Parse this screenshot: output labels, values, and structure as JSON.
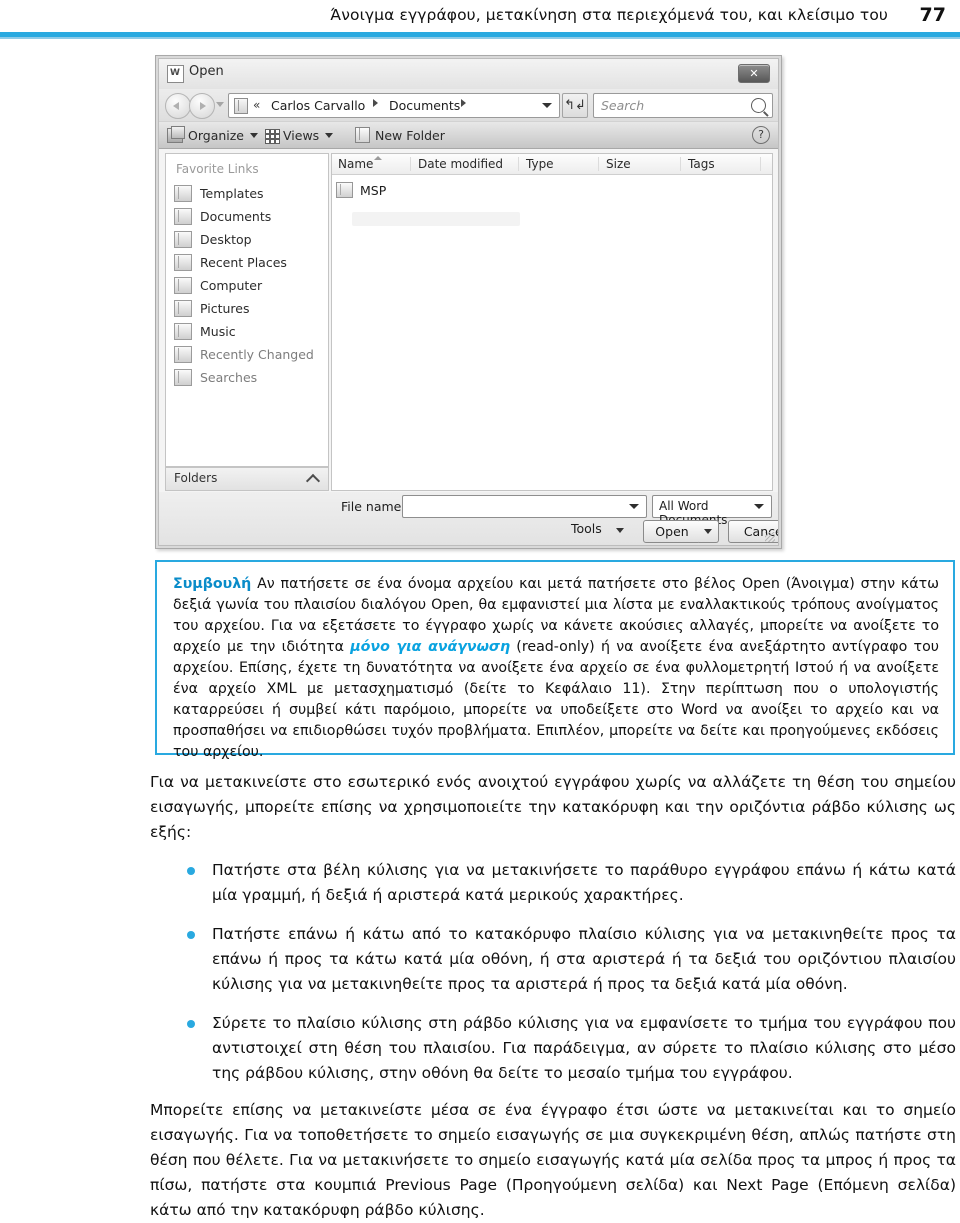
{
  "header": {
    "title": "Άνοιγμα εγγράφου, μετακίνηση στα περιεχόμενά του, και κλείσιμο του",
    "page_number": "77",
    "rule_color": "#29a9e0"
  },
  "dialog": {
    "title": "Open",
    "title_icon": "word-document-icon",
    "close_label": "✕",
    "nav": {
      "back_icon": "back-arrow-icon",
      "forward_icon": "forward-arrow-icon",
      "history_icon": "chevron-down-icon",
      "folder_icon": "folder-icon",
      "chevrons": "«",
      "breadcrumbs": [
        "Carlos Carvallo",
        "Documents"
      ],
      "address_dropdown_icon": "chevron-down-icon",
      "refresh_icon": "↰↲",
      "search_placeholder": "Search",
      "search_value": "",
      "search_icon": "search-icon"
    },
    "toolbar": {
      "organize_label": "Organize",
      "views_label": "Views",
      "new_folder_label": "New Folder",
      "help_label": "?"
    },
    "sidebar": {
      "title": "Favorite Links",
      "items": [
        {
          "label": "Templates",
          "icon": "folder-icon"
        },
        {
          "label": "Documents",
          "icon": "documents-icon"
        },
        {
          "label": "Desktop",
          "icon": "desktop-icon"
        },
        {
          "label": "Recent Places",
          "icon": "recent-places-icon"
        },
        {
          "label": "Computer",
          "icon": "computer-icon"
        },
        {
          "label": "Pictures",
          "icon": "pictures-icon"
        },
        {
          "label": "Music",
          "icon": "music-icon"
        },
        {
          "label": "Recently Changed",
          "icon": "recently-changed-icon"
        },
        {
          "label": "Searches",
          "icon": "searches-icon"
        }
      ],
      "folders_label": "Folders",
      "folders_chevron": "collapse-chevron-icon"
    },
    "filepane": {
      "columns": [
        "Name",
        "Date modified",
        "Type",
        "Size",
        "Tags"
      ],
      "sort_column": "Name",
      "sort_direction": "ascending",
      "rows": [
        {
          "name": "MSP",
          "date_modified": "",
          "type": "",
          "size": "",
          "tags": "",
          "icon": "folder-icon"
        }
      ]
    },
    "footer": {
      "file_name_label": "File name:",
      "file_name_value": "",
      "file_type_value": "All Word Documents",
      "tools_label": "Tools",
      "open_label": "Open",
      "cancel_label": "Cancel"
    }
  },
  "tip": {
    "label": "Συμβουλή",
    "text_before_em": " Αν πατήσετε σε ένα όνομα αρχείου και μετά πατήσετε στο βέλος Open (Άνοιγμα) στην κάτω δεξιά γωνία του πλαισίου διαλόγου Open, θα εμφανιστεί μια λίστα με εναλλακτικούς τρόπους ανοίγματος του αρχείου. Για να εξετάσετε το έγγραφο χωρίς να κάνετε ακούσιες αλλαγές, μπορείτε να ανοίξετε το αρχείο με την ιδιότητα ",
    "emphasis": "μόνο για ανάγνωση",
    "text_after_em": " (read-only) ή να ανοίξετε ένα ανεξάρτητο αντίγραφο του αρχείου. Επίσης, έχετε τη δυνατότητα να ανοίξετε ένα αρχείο σε ένα φυλλομετρητή Ιστού ή να ανοίξετε ένα αρχείο XML με μετασχηματισμό (δείτε το Κεφάλαιο 11). Στην περίπτωση που ο υπολογιστής καταρρεύσει ή συμβεί κάτι παρόμοιο, μπορείτε να υποδείξετε στο Word να ανοίξει το αρχείο και να προσπαθήσει να επιδιορθώσει τυχόν προβλήματα. Επιπλέον, μπορείτε να δείτε και προηγούμενες εκδόσεις του αρχείου."
  },
  "content": {
    "intro_paragraph": "Για να μετακινείστε στο εσωτερικό ενός ανοιχτού εγγράφου χωρίς να αλλάζετε τη θέση του σημείου εισαγωγής, μπορείτε επίσης να χρησιμοποιείτε την κατακόρυφη και την οριζόντια ράβδο κύλισης ως εξής:",
    "bullets": [
      "Πατήστε στα βέλη κύλισης για να μετακινήσετε το παράθυρο εγγράφου επάνω ή κάτω κατά μία γραμμή, ή δεξιά ή αριστερά κατά μερικούς χαρακτήρες.",
      "Πατήστε επάνω ή κάτω από το κατακόρυφο πλαίσιο κύλισης για να μετακινηθείτε προς τα επάνω ή προς τα κάτω κατά μία οθόνη, ή στα αριστερά ή τα δεξιά του οριζόντιου πλαισίου κύλισης για να μετακινηθείτε προς τα αριστερά ή προς τα δεξιά κατά μία οθόνη.",
      "Σύρετε το πλαίσιο κύλισης στη ράβδο κύλισης για να εμφανίσετε το τμήμα του εγγράφου που αντιστοιχεί στη θέση του πλαισίου. Για παράδειγμα, αν σύρετε το πλαίσιο κύλισης στο μέσο της ράβδου κύλισης, στην οθόνη θα δείτε το μεσαίο τμήμα του εγγράφου."
    ],
    "final_paragraph": "Μπορείτε επίσης να μετακινείστε μέσα σε ένα έγγραφο έτσι ώστε να μετακινείται και το σημείο εισαγωγής. Για να τοποθετήσετε το σημείο εισαγωγής σε μια συγκεκριμένη θέση, απλώς πατήστε στη θέση που θέλετε. Για να μετακινήσετε το σημείο εισαγωγής κατά μία σελίδα προς τα μπρος ή προς τα πίσω, πατήστε στα κουμπιά Previous Page (Προηγούμενη σελίδα) και Next Page (Επόμενη σελίδα) κάτω από την κατακόρυφη ράβδο κύλισης."
  }
}
